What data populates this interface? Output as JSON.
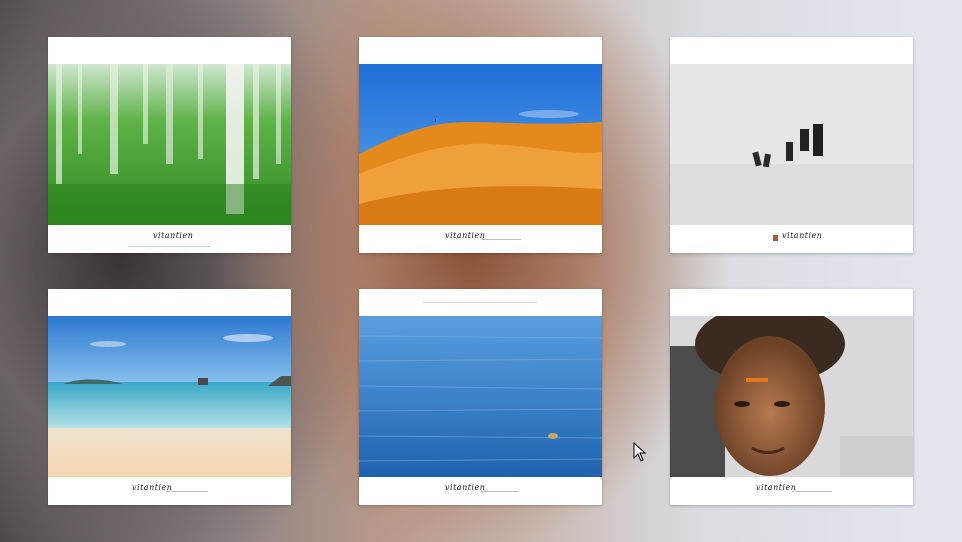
{
  "desktop": {
    "label": "",
    "cards": [
      {
        "id": "forest",
        "signature": "vitantien",
        "brand": "",
        "caption": "",
        "photo_icon": "forest-blur-image"
      },
      {
        "id": "desert",
        "signature": "vitantien",
        "brand": "",
        "caption": "",
        "photo_icon": "desert-dunes-image"
      },
      {
        "id": "snow",
        "signature": "vitantien",
        "brand": "",
        "caption": "",
        "photo_icon": "snow-figures-image"
      },
      {
        "id": "beach",
        "signature": "vitantien",
        "brand": "",
        "caption": "",
        "photo_icon": "beach-sea-image"
      },
      {
        "id": "ocean",
        "signature": "vitantien",
        "brand": "",
        "caption": "",
        "photo_icon": "ocean-swimmer-image"
      },
      {
        "id": "portrait",
        "signature": "vitantien",
        "brand": "",
        "caption": "",
        "photo_icon": "child-portrait-image"
      }
    ]
  },
  "cursor": {
    "icon": "mouse-pointer-icon"
  },
  "colors": {
    "card_background": "#ffffff",
    "forest_green": "#3f9a2a",
    "desert_orange": "#e8901e",
    "sky_blue": "#2f7fd6",
    "ocean_blue": "#2f6fb8",
    "stamp_red": "#a65a3b"
  }
}
